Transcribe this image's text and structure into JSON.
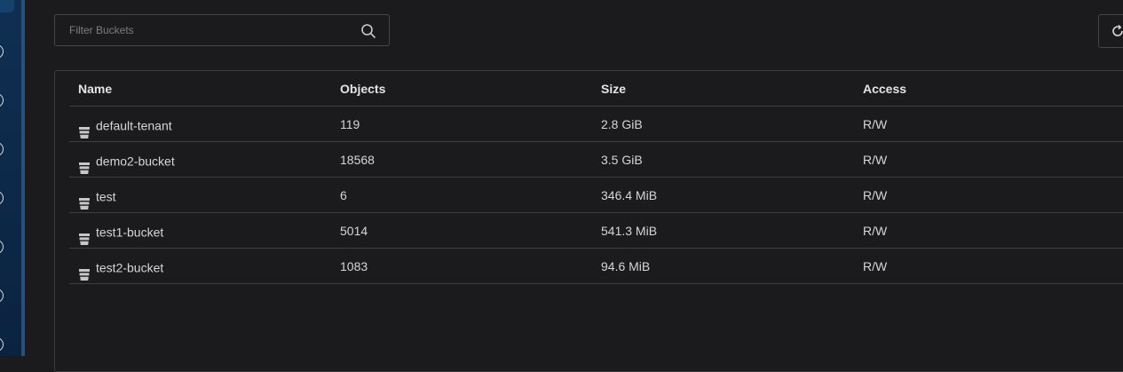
{
  "filter": {
    "placeholder": "Filter Buckets",
    "value": ""
  },
  "table": {
    "columns": [
      "Name",
      "Objects",
      "Size",
      "Access"
    ],
    "rows": [
      {
        "name": "default-tenant",
        "objects": "119",
        "size": "2.8 GiB",
        "access": "R/W"
      },
      {
        "name": "demo2-bucket",
        "objects": "18568",
        "size": "3.5 GiB",
        "access": "R/W"
      },
      {
        "name": "test",
        "objects": "6",
        "size": "346.4 MiB",
        "access": "R/W"
      },
      {
        "name": "test1-bucket",
        "objects": "5014",
        "size": "541.3 MiB",
        "access": "R/W"
      },
      {
        "name": "test2-bucket",
        "objects": "1083",
        "size": "94.6 MiB",
        "access": "R/W"
      }
    ]
  },
  "icons": {
    "search": "search-icon",
    "refresh": "refresh-icon",
    "bucket": "bucket-icon"
  },
  "colors": {
    "background": "#1b1b1d",
    "sidebar": "#0f2f52",
    "text": "#d6d6d6",
    "border": "#3c3d41"
  }
}
